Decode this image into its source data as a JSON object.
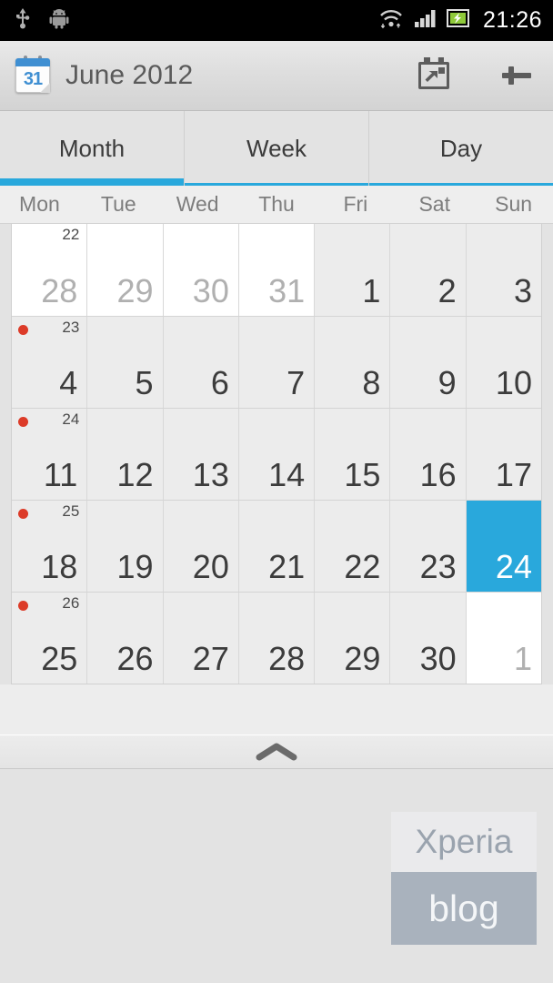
{
  "status_bar": {
    "time": "21:26",
    "left_icons": [
      "usb-icon",
      "android-robot-icon"
    ],
    "right_icons": [
      "wifi-icon",
      "signal-icon",
      "battery-icon"
    ],
    "background": "#000000"
  },
  "action_bar": {
    "app_icon_label": "31",
    "title": "June 2012",
    "today_button_name": "go-to-today",
    "add_button_label": "+"
  },
  "tabs": {
    "items": [
      {
        "label": "Month",
        "active": true
      },
      {
        "label": "Week",
        "active": false
      },
      {
        "label": "Day",
        "active": false
      }
    ],
    "indicator_color": "#29a8dc"
  },
  "calendar": {
    "weekday_headers": [
      "Mon",
      "Tue",
      "Wed",
      "Thu",
      "Fri",
      "Sat",
      "Sun"
    ],
    "selected_color": "#29a8dc",
    "event_dot_color": "#dc3b28",
    "weeks": [
      {
        "week_number": "22",
        "has_event_dot": false,
        "days": [
          {
            "label": "28",
            "month": "other",
            "selected": false
          },
          {
            "label": "29",
            "month": "other",
            "selected": false
          },
          {
            "label": "30",
            "month": "other",
            "selected": false
          },
          {
            "label": "31",
            "month": "other",
            "selected": false
          },
          {
            "label": "1",
            "month": "current",
            "selected": false
          },
          {
            "label": "2",
            "month": "current",
            "selected": false
          },
          {
            "label": "3",
            "month": "current",
            "selected": false
          }
        ]
      },
      {
        "week_number": "23",
        "has_event_dot": true,
        "days": [
          {
            "label": "4",
            "month": "current",
            "selected": false
          },
          {
            "label": "5",
            "month": "current",
            "selected": false
          },
          {
            "label": "6",
            "month": "current",
            "selected": false
          },
          {
            "label": "7",
            "month": "current",
            "selected": false
          },
          {
            "label": "8",
            "month": "current",
            "selected": false
          },
          {
            "label": "9",
            "month": "current",
            "selected": false
          },
          {
            "label": "10",
            "month": "current",
            "selected": false
          }
        ]
      },
      {
        "week_number": "24",
        "has_event_dot": true,
        "days": [
          {
            "label": "11",
            "month": "current",
            "selected": false
          },
          {
            "label": "12",
            "month": "current",
            "selected": false
          },
          {
            "label": "13",
            "month": "current",
            "selected": false
          },
          {
            "label": "14",
            "month": "current",
            "selected": false
          },
          {
            "label": "15",
            "month": "current",
            "selected": false
          },
          {
            "label": "16",
            "month": "current",
            "selected": false
          },
          {
            "label": "17",
            "month": "current",
            "selected": false
          }
        ]
      },
      {
        "week_number": "25",
        "has_event_dot": true,
        "days": [
          {
            "label": "18",
            "month": "current",
            "selected": false
          },
          {
            "label": "19",
            "month": "current",
            "selected": false
          },
          {
            "label": "20",
            "month": "current",
            "selected": false
          },
          {
            "label": "21",
            "month": "current",
            "selected": false
          },
          {
            "label": "22",
            "month": "current",
            "selected": false
          },
          {
            "label": "23",
            "month": "current",
            "selected": false
          },
          {
            "label": "24",
            "month": "current",
            "selected": true
          }
        ]
      },
      {
        "week_number": "26",
        "has_event_dot": true,
        "days": [
          {
            "label": "25",
            "month": "current",
            "selected": false
          },
          {
            "label": "26",
            "month": "current",
            "selected": false
          },
          {
            "label": "27",
            "month": "current",
            "selected": false
          },
          {
            "label": "28",
            "month": "current",
            "selected": false
          },
          {
            "label": "29",
            "month": "current",
            "selected": false
          },
          {
            "label": "30",
            "month": "current",
            "selected": false
          },
          {
            "label": "1",
            "month": "other",
            "selected": false
          }
        ]
      }
    ]
  },
  "drag_handle": {
    "icon": "chevron-up-icon"
  },
  "bottom_panel": {
    "watermark_top": "Xperia",
    "watermark_bottom": "blog"
  }
}
